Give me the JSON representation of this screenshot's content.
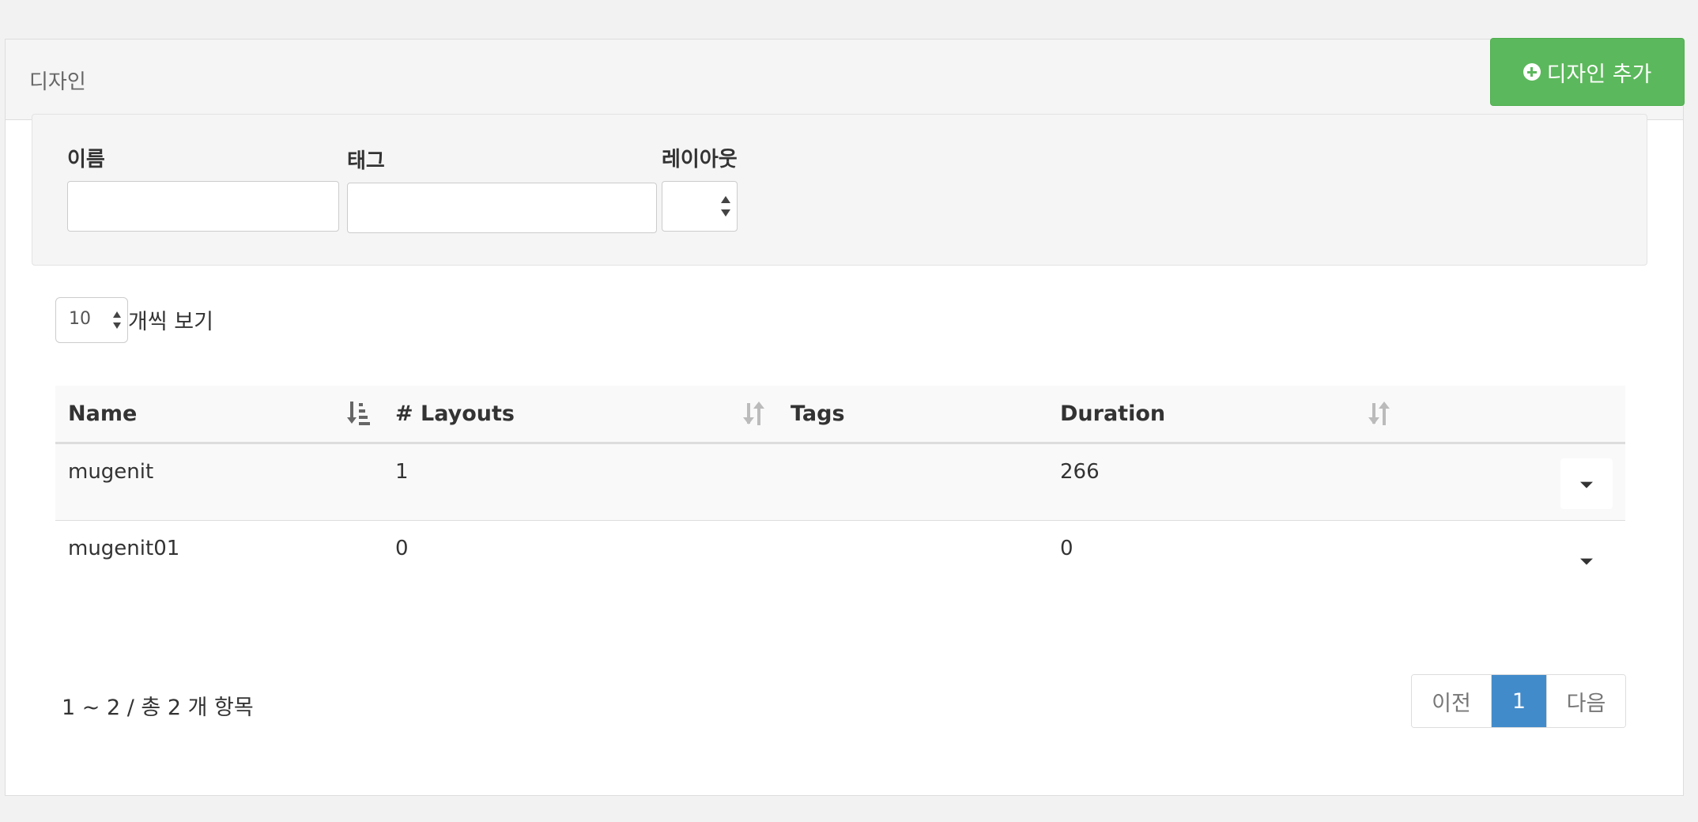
{
  "header": {
    "title": "디자인",
    "add_button_label": "디자인 추가"
  },
  "filters": {
    "name_label": "이름",
    "name_value": "",
    "tag_label": "태그",
    "tag_value": "",
    "layout_label": "레이아웃",
    "layout_value": ""
  },
  "length_menu": {
    "value": "10",
    "label": "개씩 보기"
  },
  "table": {
    "columns": [
      "Name",
      "# Layouts",
      "Tags",
      "Duration"
    ],
    "rows": [
      {
        "name": "mugenit",
        "layouts": "1",
        "tags": "",
        "duration": "266"
      },
      {
        "name": "mugenit01",
        "layouts": "0",
        "tags": "",
        "duration": "0"
      }
    ]
  },
  "info": "1 ~ 2 / 총 2 개 항목",
  "pagination": {
    "prev_label": "이전",
    "current_page": "1",
    "next_label": "다음"
  },
  "colors": {
    "accent_green": "#5cb85c",
    "page_active_blue": "#428bca"
  }
}
